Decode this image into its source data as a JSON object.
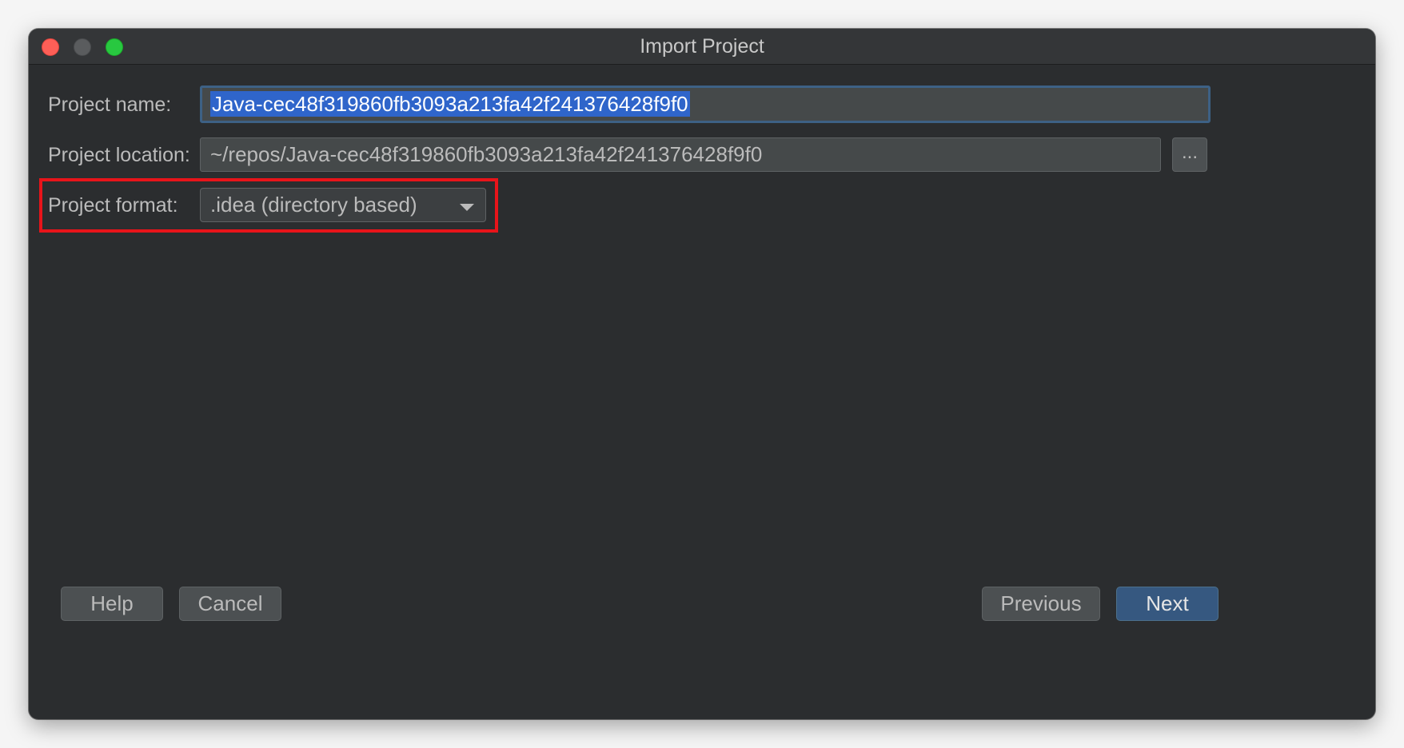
{
  "window": {
    "title": "Import Project"
  },
  "form": {
    "project_name_label": "Project name:",
    "project_name_value": "Java-cec48f319860fb3093a213fa42f241376428f9f0",
    "project_location_label": "Project location:",
    "project_location_value": "~/repos/Java-cec48f319860fb3093a213fa42f241376428f9f0",
    "browse_label": "...",
    "project_format_label": "Project format:",
    "project_format_value": ".idea (directory based)"
  },
  "footer": {
    "help_label": "Help",
    "cancel_label": "Cancel",
    "previous_label": "Previous",
    "next_label": "Next"
  },
  "colors": {
    "accent": "#365880",
    "selection": "#2f65ca",
    "annotation_highlight": "#e8141a",
    "window_background": "#2b2d2f"
  },
  "icons": [
    "close-icon",
    "minimize-icon",
    "zoom-icon",
    "chevron-down-icon"
  ]
}
